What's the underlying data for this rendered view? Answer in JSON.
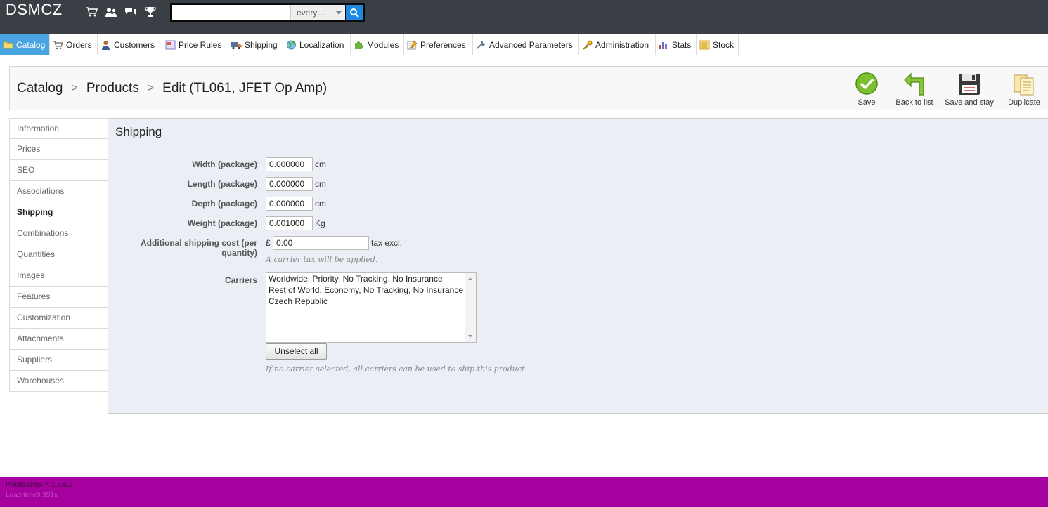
{
  "header": {
    "logo": "DSMCZ",
    "quick_icons": [
      "cart-icon",
      "customers-icon",
      "messages-icon",
      "trophy-icon"
    ],
    "search": {
      "value": "",
      "placeholder": "",
      "scope": "every…"
    }
  },
  "menu": [
    {
      "label": "Catalog",
      "icon": "folder-icon",
      "active": true
    },
    {
      "label": "Orders",
      "icon": "cart-icon"
    },
    {
      "label": "Customers",
      "icon": "user-icon"
    },
    {
      "label": "Price Rules",
      "icon": "price-tag-icon"
    },
    {
      "label": "Shipping",
      "icon": "truck-icon"
    },
    {
      "label": "Localization",
      "icon": "globe-icon"
    },
    {
      "label": "Modules",
      "icon": "puzzle-icon"
    },
    {
      "label": "Preferences",
      "icon": "preferences-icon"
    },
    {
      "label": "Advanced Parameters",
      "icon": "wrench-icon"
    },
    {
      "label": "Administration",
      "icon": "key-icon"
    },
    {
      "label": "Stats",
      "icon": "bar-chart-icon"
    },
    {
      "label": "Stock",
      "icon": "stock-icon"
    }
  ],
  "breadcrumb": {
    "items": [
      "Catalog",
      "Products",
      "Edit (TL061, JFET Op Amp)"
    ],
    "separator": ">"
  },
  "toolbar": {
    "save": "Save",
    "back": "Back to list",
    "save_stay": "Save and stay",
    "duplicate": "Duplicate"
  },
  "tabs": [
    {
      "label": "Information"
    },
    {
      "label": "Prices"
    },
    {
      "label": "SEO"
    },
    {
      "label": "Associations"
    },
    {
      "label": "Shipping",
      "active": true
    },
    {
      "label": "Combinations"
    },
    {
      "label": "Quantities"
    },
    {
      "label": "Images"
    },
    {
      "label": "Features"
    },
    {
      "label": "Customization"
    },
    {
      "label": "Attachments"
    },
    {
      "label": "Suppliers"
    },
    {
      "label": "Warehouses"
    }
  ],
  "shipping": {
    "title": "Shipping",
    "width": {
      "label": "Width (package)",
      "value": "0.000000",
      "unit": "cm"
    },
    "length": {
      "label": "Length (package)",
      "value": "0.000000",
      "unit": "cm"
    },
    "depth": {
      "label": "Depth (package)",
      "value": "0.000000",
      "unit": "cm"
    },
    "weight": {
      "label": "Weight (package)",
      "value": "0.001000",
      "unit": "Kg"
    },
    "additional_cost": {
      "label_line1": "Additional shipping cost (per",
      "label_line2": "quantity)",
      "currency": "£",
      "value": "0.00",
      "unit": "tax excl.",
      "hint": "A carrier tax will be applied."
    },
    "carriers": {
      "label": "Carriers",
      "options": [
        "Worldwide, Priority, No Tracking, No Insurance",
        "Rest of World, Economy, No Tracking, No Insurance",
        "Czech Republic"
      ],
      "unselect_label": "Unselect all",
      "hint": "If no carrier selected, all carriers can be used to ship this product."
    }
  },
  "footer": {
    "version": "PrestaShop™ 1.5.6.2",
    "load_time": "Load time0.351s"
  },
  "colors": {
    "topbar": "#3a3f46",
    "menu_active": "#49a5e2",
    "panel_bg": "#ebeff5",
    "footer": "#a6009f",
    "search_button": "#1e88e5"
  }
}
